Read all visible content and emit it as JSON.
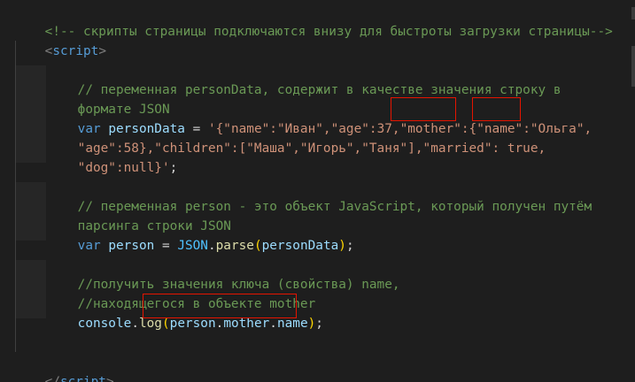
{
  "lines": {
    "l1": "<!-- скрипты страницы подключаются внизу для быстроты загрузки страницы-->",
    "l2_open": "<",
    "l2_tag": "script",
    "l2_close": ">",
    "l4": "// переменная personData, содержит в качестве значения строку в",
    "l5": "формате JSON",
    "l6_kw": "var",
    "l6_var": "personData",
    "l6_eq": " = ",
    "l6_str1": "'{\"name\":\"Иван\",\"age\":37,",
    "l6_str_mother": "\"mother\"",
    "l6_str2": ":{",
    "l6_str_name": "\"name\"",
    "l6_str3": ":\"Ольга\",",
    "l7": "\"age\":58},\"children\":[\"Маша\",\"Игорь\",\"Таня\"],\"married\": true,",
    "l8_str": "\"dog\":null}'",
    "l8_semi": ";",
    "l10": "// переменная person - это объект JavaScript, который получен путём",
    "l11": "парсинга строки JSON",
    "l12_kw": "var",
    "l12_var": "person",
    "l12_eq": " = ",
    "l12_json": "JSON",
    "l12_dot": ".",
    "l12_fn": "parse",
    "l12_po": "(",
    "l12_arg": "personData",
    "l12_pc": ")",
    "l12_semi": ";",
    "l14": "//получить значения ключа (свойства) name,",
    "l15": "//находящегося в объекте mother",
    "l16_obj": "console",
    "l16_dot": ".",
    "l16_fn": "log",
    "l16_po": "(",
    "l16_p1": "person",
    "l16_d1": ".",
    "l16_p2": "mother",
    "l16_d2": ".",
    "l16_p3": "name",
    "l16_pc": ")",
    "l16_semi": ";",
    "l19_open": "</",
    "l19_tag": "script",
    "l19_close": ">"
  },
  "colors": {
    "background": "#1e1e1e",
    "comment": "#6a9955",
    "keyword": "#569cd6",
    "variable": "#9cdcfe",
    "string": "#ce9178",
    "function": "#dcdcaa",
    "highlight_box": "#e51400"
  }
}
